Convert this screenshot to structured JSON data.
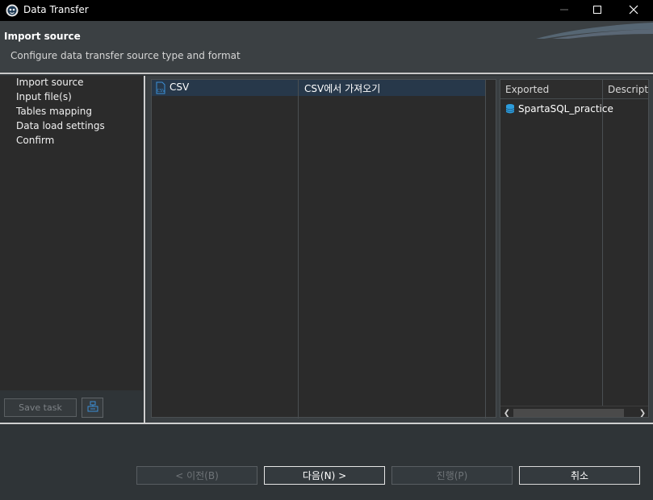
{
  "window": {
    "title": "Data Transfer"
  },
  "header": {
    "title": "Import source",
    "description": "Configure data transfer source type and format"
  },
  "nav": {
    "items": [
      {
        "label": "Import source"
      },
      {
        "label": "Input file(s)"
      },
      {
        "label": "Tables mapping"
      },
      {
        "label": "Data load settings"
      },
      {
        "label": "Confirm"
      }
    ],
    "save_task_label": "Save task"
  },
  "sources": {
    "rows": [
      {
        "icon": "csv-file-icon",
        "name": "CSV",
        "description": "CSV에서 가져오기"
      }
    ]
  },
  "targets": {
    "columns": [
      "Exported",
      "Description"
    ],
    "rows": [
      {
        "icon": "database-icon",
        "name": "SpartaSQL_practice"
      }
    ]
  },
  "footer": {
    "back_label": "< 이전(B)",
    "next_label": "다음(N) >",
    "finish_label": "진행(P)",
    "cancel_label": "취소"
  },
  "colors": {
    "selection": "#27384a",
    "accent": "#2d9cdb",
    "panel": "#2b2b2b"
  }
}
